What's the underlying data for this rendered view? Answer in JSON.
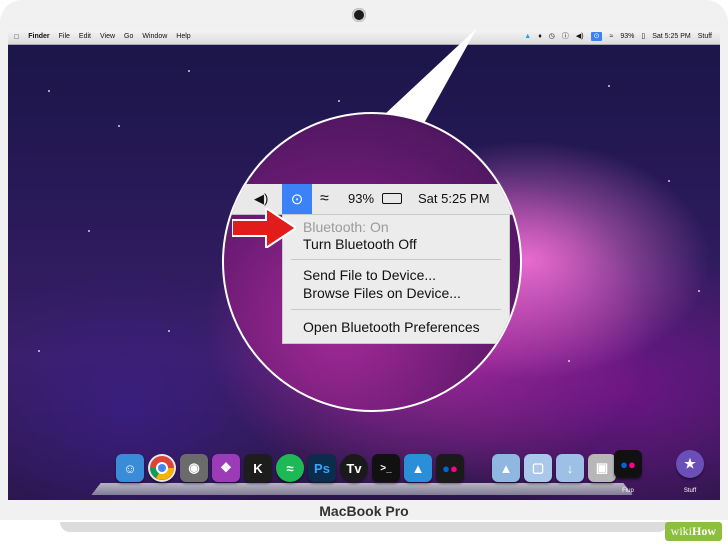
{
  "menubar": {
    "apple": "",
    "items": [
      "Finder",
      "File",
      "Edit",
      "View",
      "Go",
      "Window",
      "Help"
    ],
    "battery": "93%",
    "clock": "Sat 5:25 PM",
    "user": "Stuff"
  },
  "zoom": {
    "battery": "93%",
    "clock": "Sat 5:25 PM",
    "bluetooth_menu": {
      "status": "Bluetooth: On",
      "toggle": "Turn Bluetooth Off",
      "send_file": "Send File to Device...",
      "browse_files": "Browse Files on Device...",
      "preferences": "Open Bluetooth Preferences"
    }
  },
  "dock": {
    "labels": {
      "flup": "Flup",
      "stuff": "Stuff"
    }
  },
  "brand": "MacBook Pro",
  "watermark": {
    "wiki": "wiki",
    "how": "How"
  },
  "colors": {
    "accent": "#3b82f6",
    "arrow": "#e21b1b"
  }
}
